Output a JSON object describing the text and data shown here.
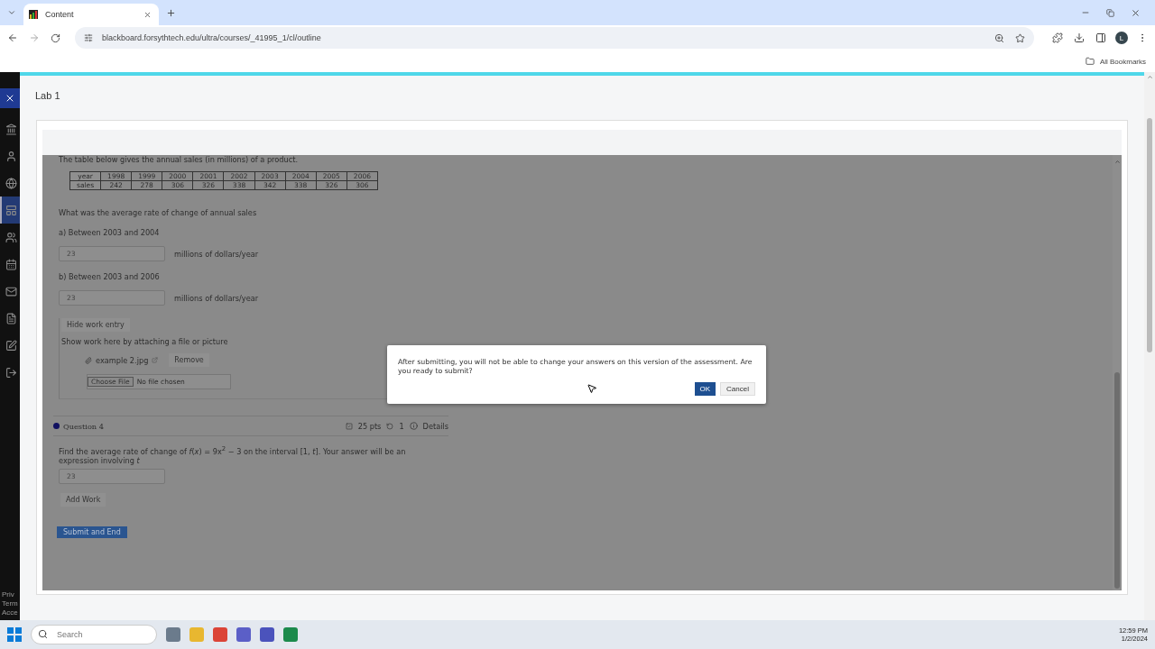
{
  "browser": {
    "tab": {
      "title": "Content"
    },
    "url": "blackboard.forsythtech.edu/ultra/courses/_41995_1/cl/outline",
    "profile": "L",
    "bookmarks": "All Bookmarks"
  },
  "sidebar": {
    "items": [
      {
        "selected": false
      },
      {
        "selected": false
      },
      {
        "selected": false
      },
      {
        "selected": true
      },
      {
        "selected": false
      },
      {
        "selected": false
      },
      {
        "selected": false
      },
      {
        "selected": false
      },
      {
        "selected": false
      },
      {
        "selected": false
      }
    ],
    "footer": [
      "Priv",
      "Term",
      "Acce"
    ]
  },
  "page": {
    "title": "Lab 1"
  },
  "question_3": {
    "intro": "The table below gives the annual sales (in millions) of a product.",
    "table": [
      [
        "year",
        "1998",
        "1999",
        "2000",
        "2001",
        "2002",
        "2003",
        "2004",
        "2005",
        "2006"
      ],
      [
        "sales",
        "242",
        "278",
        "306",
        "326",
        "338",
        "342",
        "338",
        "326",
        "306"
      ]
    ],
    "prompt": "What was the average rate of change of annual sales",
    "parts": [
      {
        "label": "a) Between 2003 and 2004",
        "value": "23",
        "unit": "millions of dollars/year"
      },
      {
        "label": "b) Between 2003 and 2006",
        "value": "23",
        "unit": "millions of dollars/year"
      }
    ],
    "work": {
      "toggle": "Hide work entry",
      "hint": "Show work here by attaching a file or picture",
      "attachment": "example 2.jpg",
      "remove": "Remove",
      "choose": "Choose File",
      "chosen": "No file chosen"
    }
  },
  "question_4": {
    "title": "Question 4",
    "points": "25 pts",
    "attempts": "1",
    "details": "Details",
    "text": "Find the average rate of change of *f*(*x*) = 9x$^{2}$ − 3 on the interval [1, *t*]. Your answer will be an expression involving *t*",
    "value": "23",
    "add_work": "Add Work"
  },
  "submit": "Submit and End",
  "dialog": {
    "message": "After submitting, you will not be able to change your answers on this version of the assessment. Are you ready to submit?",
    "ok": "OK",
    "cancel": "Cancel"
  },
  "taskbar": {
    "search": {
      "placeholder": "Search"
    },
    "time": "12:59 PM",
    "date": "1/2/2024"
  }
}
